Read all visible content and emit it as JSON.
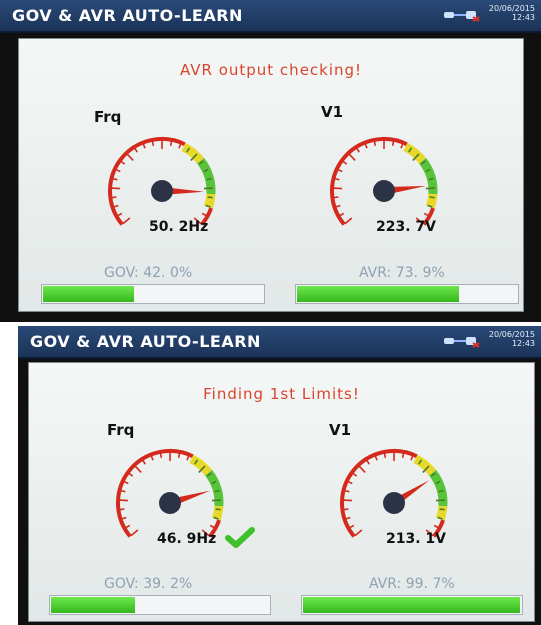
{
  "screens": [
    {
      "title": "GOV & AVR AUTO-LEARN",
      "date": "20/06/2015",
      "time": "12:43",
      "message": "AVR  output  checking!",
      "gauges": [
        {
          "label": "Frq",
          "readout": "50. 2Hz",
          "needle_level": 0.85
        },
        {
          "label": "V1",
          "readout": "223. 7V",
          "needle_level": 0.82
        }
      ],
      "bars": [
        {
          "label": "GOV:  42. 0%",
          "progress": 0.42
        },
        {
          "label": "AVR:  73. 9%",
          "progress": 0.739
        }
      ]
    },
    {
      "title": "GOV & AVR AUTO-LEARN",
      "date": "20/06/2015",
      "time": "12:43",
      "message": "Finding  1st  Limits!",
      "gauges": [
        {
          "label": "Frq",
          "readout": "46. 9Hz",
          "needle_level": 0.78
        },
        {
          "label": "V1",
          "readout": "213. 1V",
          "needle_level": 0.72
        }
      ],
      "bars": [
        {
          "label": "GOV:  39. 2%",
          "progress": 0.392
        },
        {
          "label": "AVR:  99. 7%",
          "progress": 0.997
        }
      ]
    }
  ],
  "colors": {
    "message": "#d8452e",
    "gauge_red": "#d42a1e",
    "gauge_yellow": "#e8d82a",
    "gauge_green": "#58c43a",
    "bar_fill": "#44c82a",
    "check": "#3fbf2a"
  }
}
